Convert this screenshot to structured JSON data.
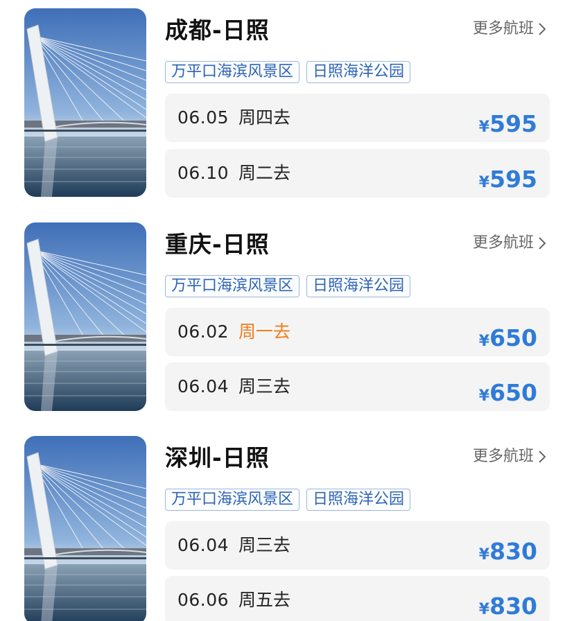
{
  "more_label": "更多航班",
  "currency": "¥",
  "accent_colors": {
    "price": "#2f7bd8",
    "highlight_day": "#f07c1b",
    "tag_text": "#2d63b5"
  },
  "routes": [
    {
      "title": "成都-日照",
      "tags": [
        "万平口海滨风景区",
        "日照海洋公园"
      ],
      "fares": [
        {
          "date": "06.05",
          "day": "周四去",
          "price": "595",
          "highlight": false
        },
        {
          "date": "06.10",
          "day": "周二去",
          "price": "595",
          "highlight": false
        }
      ]
    },
    {
      "title": "重庆-日照",
      "tags": [
        "万平口海滨风景区",
        "日照海洋公园"
      ],
      "fares": [
        {
          "date": "06.02",
          "day": "周一去",
          "price": "650",
          "highlight": true
        },
        {
          "date": "06.04",
          "day": "周三去",
          "price": "650",
          "highlight": false
        }
      ]
    },
    {
      "title": "深圳-日照",
      "tags": [
        "万平口海滨风景区",
        "日照海洋公园"
      ],
      "fares": [
        {
          "date": "06.04",
          "day": "周三去",
          "price": "830",
          "highlight": false
        },
        {
          "date": "06.06",
          "day": "周五去",
          "price": "830",
          "highlight": false
        }
      ]
    }
  ]
}
